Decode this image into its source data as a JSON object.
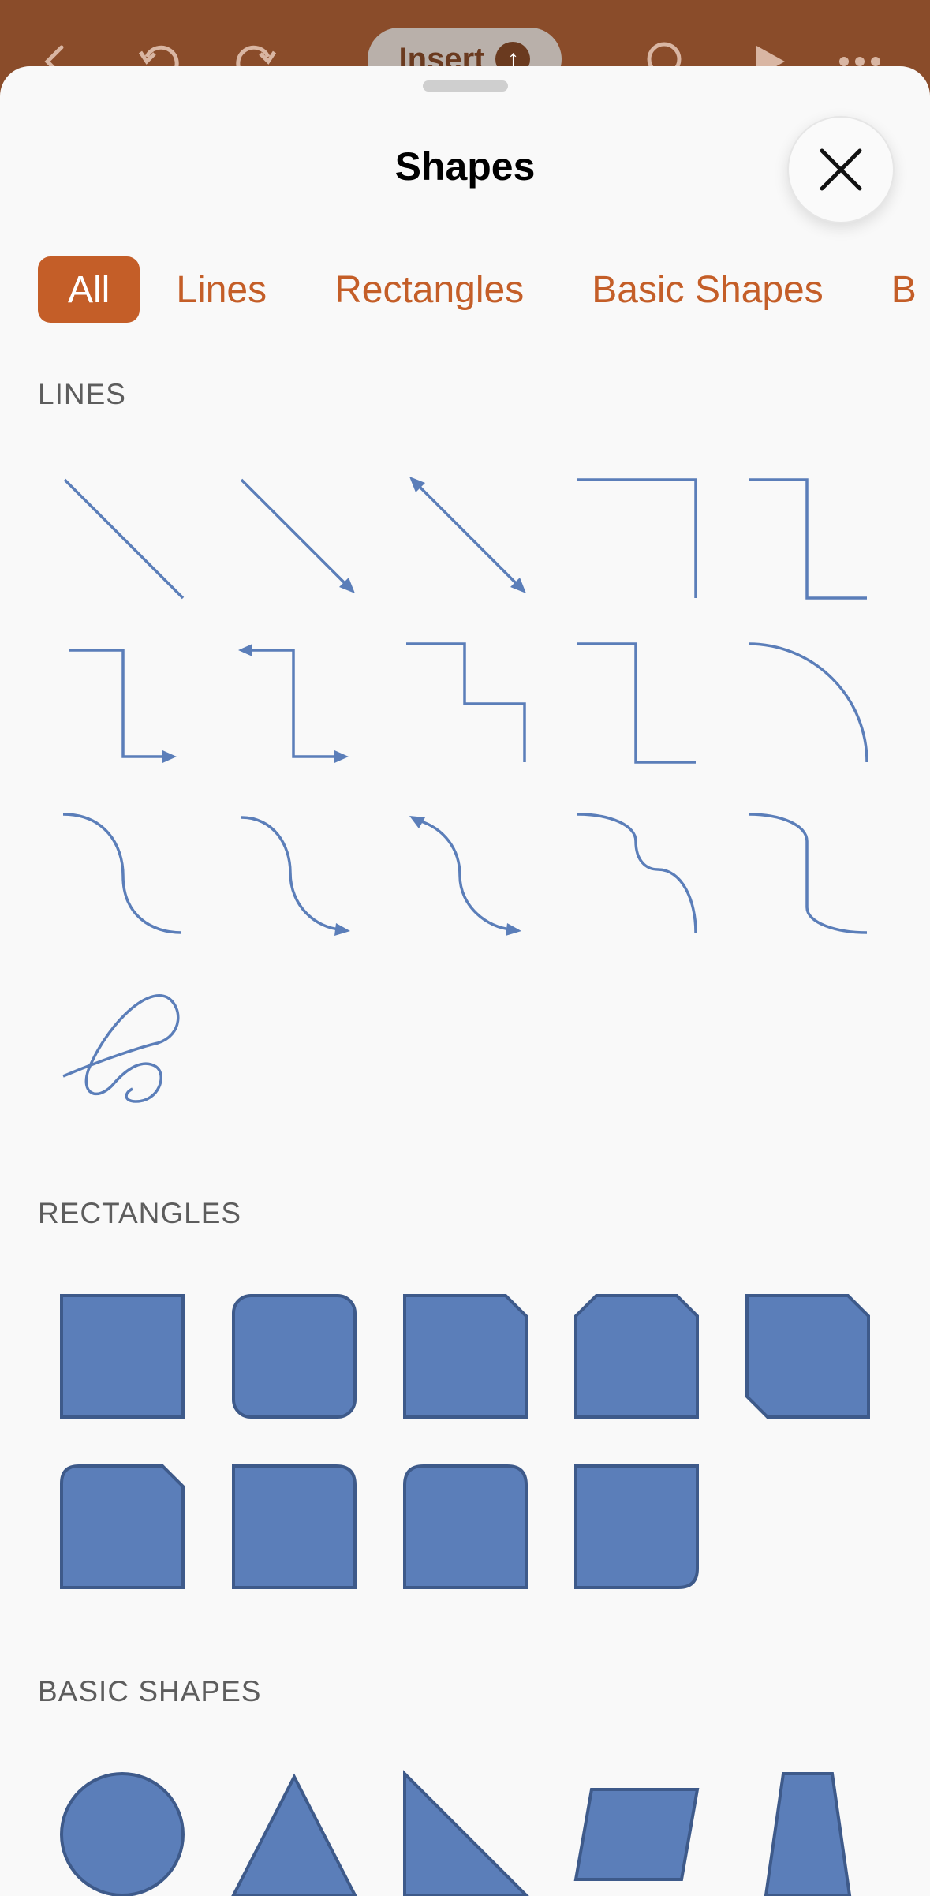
{
  "toolbar": {
    "insert_label": "Insert",
    "icons": [
      "back-icon",
      "undo-icon",
      "redo-icon",
      "search-icon",
      "play-icon",
      "more-icon"
    ]
  },
  "sheet": {
    "title": "Shapes",
    "close_icon": "close-icon"
  },
  "tabs": [
    {
      "label": "All",
      "active": true
    },
    {
      "label": "Lines",
      "active": false
    },
    {
      "label": "Rectangles",
      "active": false
    },
    {
      "label": "Basic Shapes",
      "active": false
    },
    {
      "label": "B",
      "active": false
    }
  ],
  "sections": {
    "lines": "LINES",
    "rectangles": "RECTANGLES",
    "basic_shapes": "BASIC SHAPES"
  },
  "colors": {
    "accent": "#c45e28",
    "toolbar": "#8a4c2a",
    "shape_fill": "#5b7eb9",
    "shape_stroke": "#3e5a8a",
    "line": "#5b7eb9"
  }
}
